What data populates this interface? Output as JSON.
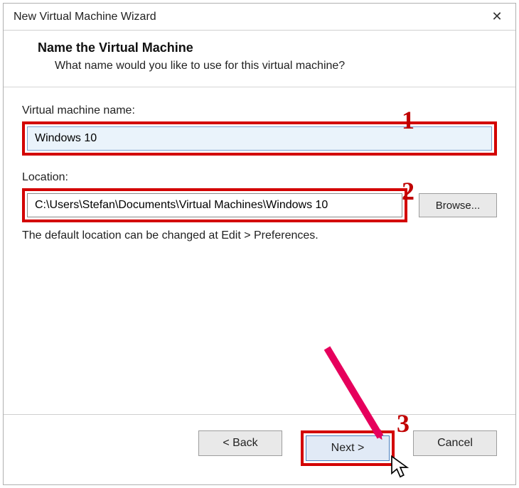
{
  "titlebar": {
    "title": "New Virtual Machine Wizard"
  },
  "header": {
    "heading": "Name the Virtual Machine",
    "subheading": "What name would you like to use for this virtual machine?"
  },
  "fields": {
    "name_label": "Virtual machine name:",
    "name_value": "Windows 10",
    "location_label": "Location:",
    "location_value": "C:\\Users\\Stefan\\Documents\\Virtual Machines\\Windows 10",
    "browse_label": "Browse...",
    "note": "The default location can be changed at Edit > Preferences."
  },
  "footer": {
    "back_label": "< Back",
    "next_label": "Next >",
    "cancel_label": "Cancel"
  },
  "annotations": {
    "one": "1",
    "two": "2",
    "three": "3"
  }
}
